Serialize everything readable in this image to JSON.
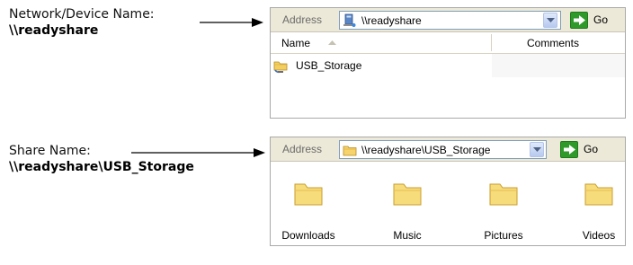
{
  "callouts": {
    "network": {
      "label": "Network/Device Name:",
      "value": "\\\\readyshare"
    },
    "share": {
      "label": "Share Name:",
      "value": "\\\\readyshare\\USB_Storage"
    }
  },
  "explorer_top": {
    "address_label": "Address",
    "address_value": "\\\\readyshare",
    "address_icon": "network-computer-icon",
    "go_label": "Go",
    "columns": [
      "Name",
      "Comments"
    ],
    "items": [
      {
        "name": "USB_Storage",
        "icon": "network-share-folder-icon"
      }
    ]
  },
  "explorer_bottom": {
    "address_label": "Address",
    "address_value": "\\\\readyshare\\USB_Storage",
    "address_icon": "folder-icon",
    "go_label": "Go",
    "folders": [
      "Downloads",
      "Music",
      "Pictures",
      "Videos"
    ]
  },
  "colors": {
    "toolbar_bg": "#ece9d8",
    "go_green": "#2f9a2a",
    "folder_yellow": "#f7dc7c"
  }
}
